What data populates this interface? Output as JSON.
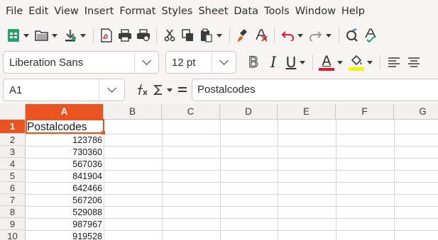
{
  "menubar": {
    "items": [
      "File",
      "Edit",
      "View",
      "Insert",
      "Format",
      "Styles",
      "Sheet",
      "Data",
      "Tools",
      "Window",
      "Help"
    ]
  },
  "toolbar": {
    "icons": [
      "new-icon",
      "open-icon",
      "save-icon",
      "export-pdf-icon",
      "print-icon",
      "print-preview-icon",
      "cut-icon",
      "copy-icon",
      "paste-icon",
      "clone-formatting-icon",
      "clear-formatting-icon",
      "undo-icon",
      "redo-icon",
      "find-replace-icon",
      "spelling-icon"
    ]
  },
  "format": {
    "font_name": "Liberation Sans",
    "font_size": "12 pt",
    "bold_glyph": "B",
    "italic_glyph": "I",
    "underline_glyph": "U",
    "font_color_glyph": "A",
    "font_color": "#e01b24",
    "highlight_color": "#f6f500"
  },
  "formula_bar": {
    "name_box": "A1",
    "content": "Postalcodes"
  },
  "grid": {
    "columns": [
      "A",
      "B",
      "C",
      "D",
      "E",
      "F",
      "G"
    ],
    "rows": [
      "1",
      "2",
      "3",
      "4",
      "5",
      "6",
      "7",
      "8",
      "9",
      "10"
    ],
    "column_a": [
      "Postalcodes",
      "123786",
      "730360",
      "567036",
      "841904",
      "642466",
      "567206",
      "529088",
      "987967",
      "919528"
    ],
    "accent_color": "#e95420"
  }
}
